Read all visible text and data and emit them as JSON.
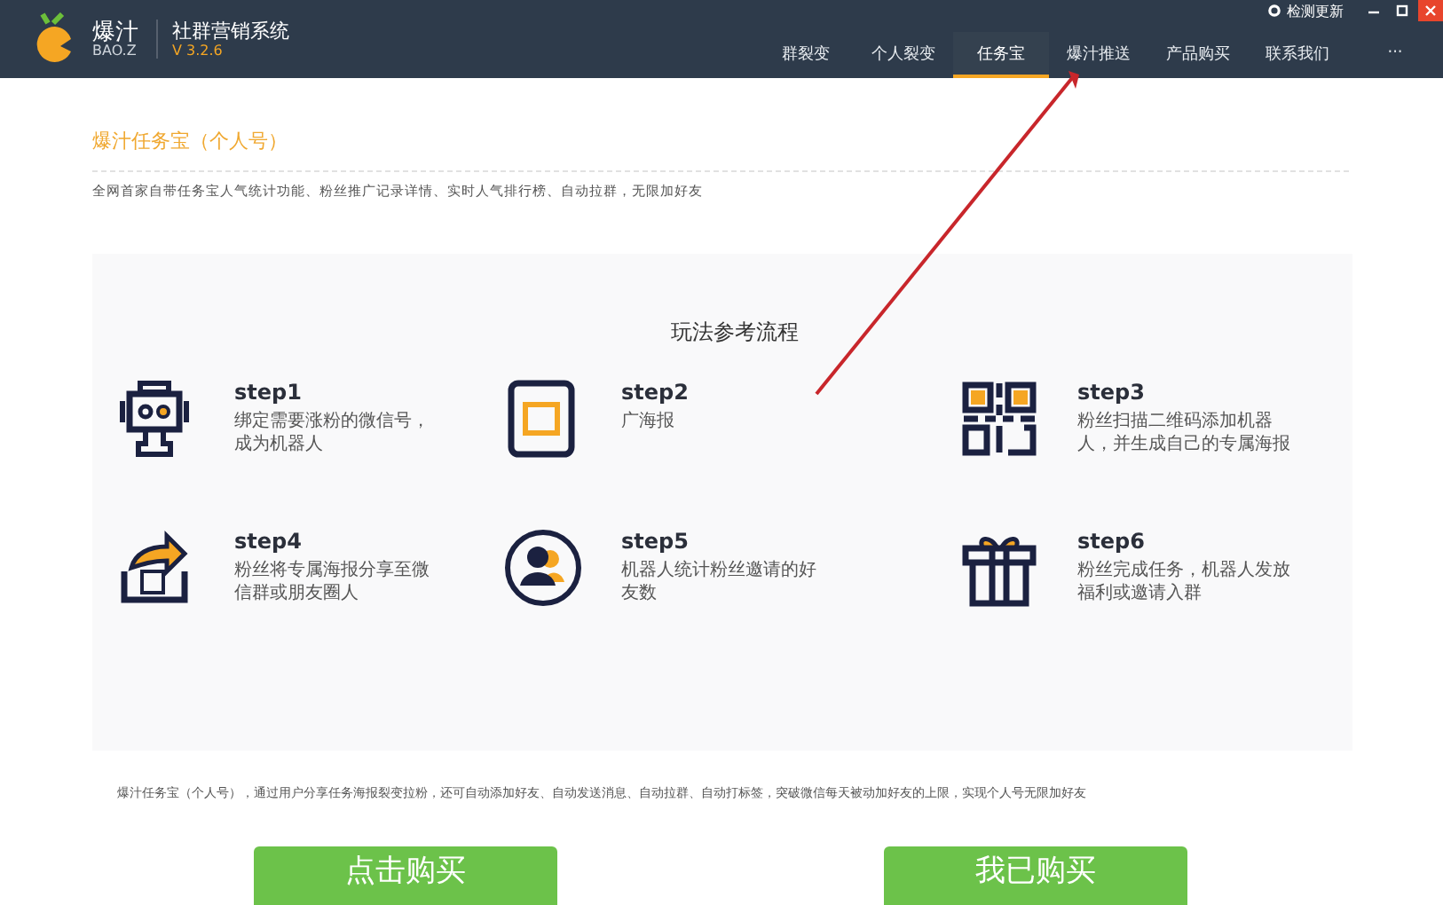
{
  "app": {
    "brand": "爆汁",
    "brand_sub": "BAO.Z",
    "product": "社群营销系统",
    "version": "V 3.2.6",
    "update": "检测更新"
  },
  "tabs": [
    {
      "label": "群裂变",
      "selected": false
    },
    {
      "label": "个人裂变",
      "selected": false
    },
    {
      "label": "任务宝",
      "selected": true
    },
    {
      "label": "爆汁推送",
      "selected": false
    },
    {
      "label": "产品购买",
      "selected": false
    },
    {
      "label": "联系我们",
      "selected": false
    },
    {
      "label": "···",
      "selected": false
    }
  ],
  "page": {
    "title": "爆汁任务宝（个人号）",
    "intro": "全网首家自带任务宝人气统计功能、粉丝推广记录详情、实时人气排行榜、自动拉群，无限加好友"
  },
  "flow": {
    "title": "玩法参考流程",
    "steps": [
      {
        "kind": "robot",
        "title": "step1",
        "text": "绑定需要涨粉的微信号，成为机器人"
      },
      {
        "kind": "poster",
        "title": "step2",
        "text": "广海报"
      },
      {
        "kind": "qr",
        "title": "step3",
        "text": "粉丝扫描二维码添加机器人，并生成自己的专属海报"
      },
      {
        "kind": "share",
        "title": "step4",
        "text": "粉丝将专属海报分享至微信群或朋友圈人"
      },
      {
        "kind": "people",
        "title": "step5",
        "text": "机器人统计粉丝邀请的好友数"
      },
      {
        "kind": "gift",
        "title": "step6",
        "text": "粉丝完成任务，机器人发放福利或邀请入群"
      }
    ]
  },
  "summary": "爆汁任务宝（个人号），通过用户分享任务海报裂变拉粉，还可自动添加好友、自动发送消息、自动拉群、自动打标签，突破微信每天被动加好友的上限，实现个人号无限加好友",
  "buttons": [
    "点击购买",
    "我已购买"
  ]
}
